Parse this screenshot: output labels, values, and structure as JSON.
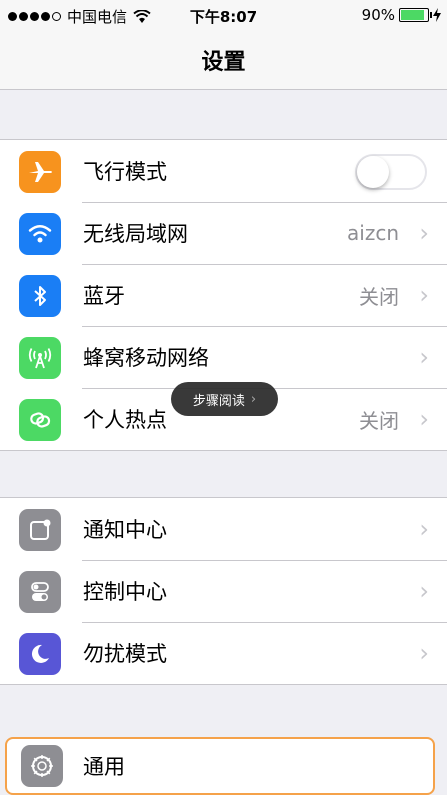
{
  "status_bar": {
    "carrier": "中国电信",
    "time": "下午8:07",
    "battery_percent": "90%",
    "battery_level": 0.9,
    "signal_bars_filled": 4,
    "signal_bars_total": 5
  },
  "nav": {
    "title": "设置"
  },
  "groups": [
    {
      "rows": [
        {
          "label": "飞行模式",
          "icon": "airplane-icon",
          "icon_color": "#f7931e",
          "toggle": false
        },
        {
          "label": "无线局域网",
          "icon": "wifi-icon",
          "icon_color": "#1a7ef5",
          "value": "aizcn"
        },
        {
          "label": "蓝牙",
          "icon": "bluetooth-icon",
          "icon_color": "#1a7ef5",
          "value": "关闭"
        },
        {
          "label": "蜂窝移动网络",
          "icon": "cellular-icon",
          "icon_color": "#4cd964",
          "value": ""
        },
        {
          "label": "个人热点",
          "icon": "hotspot-icon",
          "icon_color": "#4cd964",
          "value": "关闭"
        }
      ]
    },
    {
      "rows": [
        {
          "label": "通知中心",
          "icon": "notification-center-icon",
          "icon_color": "#8e8e93"
        },
        {
          "label": "控制中心",
          "icon": "control-center-icon",
          "icon_color": "#8e8e93"
        },
        {
          "label": "勿扰模式",
          "icon": "moon-icon",
          "icon_color": "#5856d6"
        }
      ]
    },
    {
      "rows": [
        {
          "label": "通用",
          "icon": "gear-icon",
          "icon_color": "#8e8e93"
        }
      ]
    }
  ],
  "overlay": {
    "tooltip_text": "步骤阅读",
    "highlight_color": "#f5a24a"
  }
}
